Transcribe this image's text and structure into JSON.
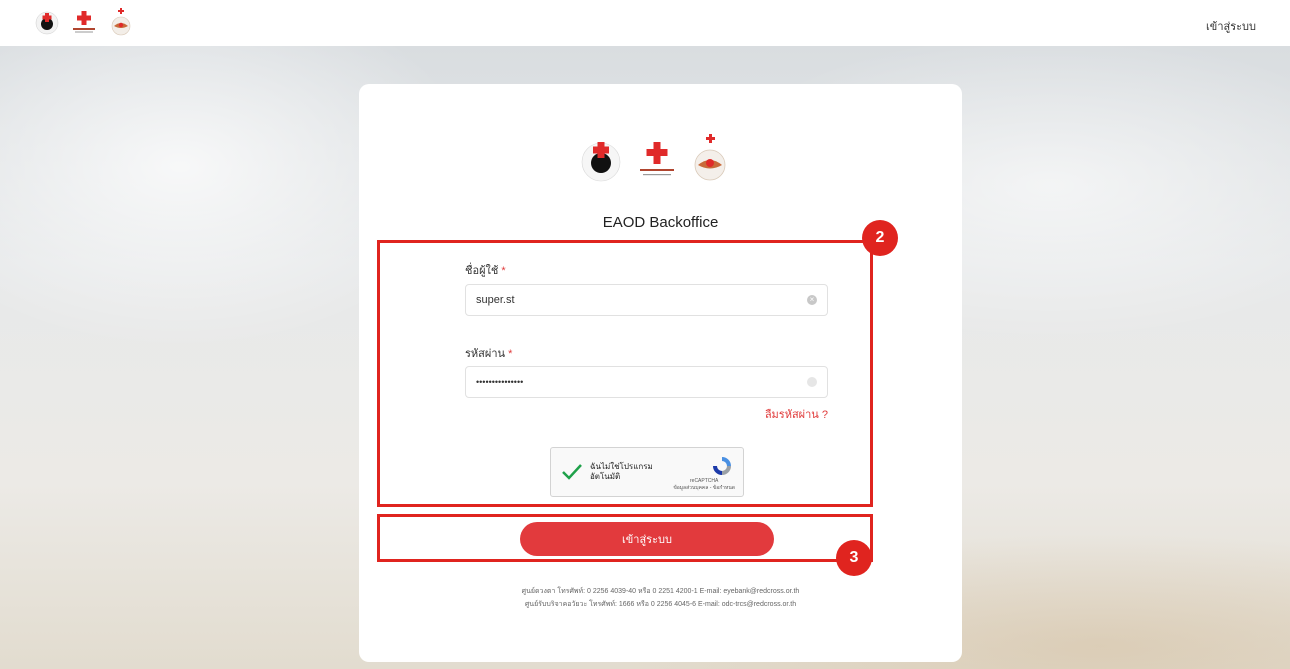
{
  "header": {
    "login_link": "เข้าสู่ระบบ"
  },
  "card": {
    "title": "EAOD Backoffice",
    "username": {
      "label": "ชื่อผู้ใช้",
      "required_mark": "*",
      "value": "super.st"
    },
    "password": {
      "label": "รหัสผ่าน",
      "required_mark": "*",
      "value": "•••••••••••••••"
    },
    "forgot_password": "ลืมรหัสผ่าน ?",
    "captcha": {
      "text": "ฉันไม่ใช่โปรแกรมอัตโนมัติ",
      "brand": "reCAPTCHA",
      "links": "ข้อมูลส่วนบุคคล - ข้อกำหนด"
    },
    "login_button": "เข้าสู่ระบบ",
    "footer": [
      "ศูนย์ดวงตา โทรศัพท์: 0 2256 4039-40 หรือ 0 2251 4200-1 E-mail: eyebank@redcross.or.th",
      "ศูนย์รับบริจาคอวัยวะ โทรศัพท์: 1666 หรือ 0 2256 4045-6 E-mail: odc-trcs@redcross.or.th"
    ]
  },
  "annotations": {
    "badge_2": "2",
    "badge_3": "3"
  },
  "colors": {
    "accent": "#e23a3d",
    "annotation": "#e0241f"
  }
}
